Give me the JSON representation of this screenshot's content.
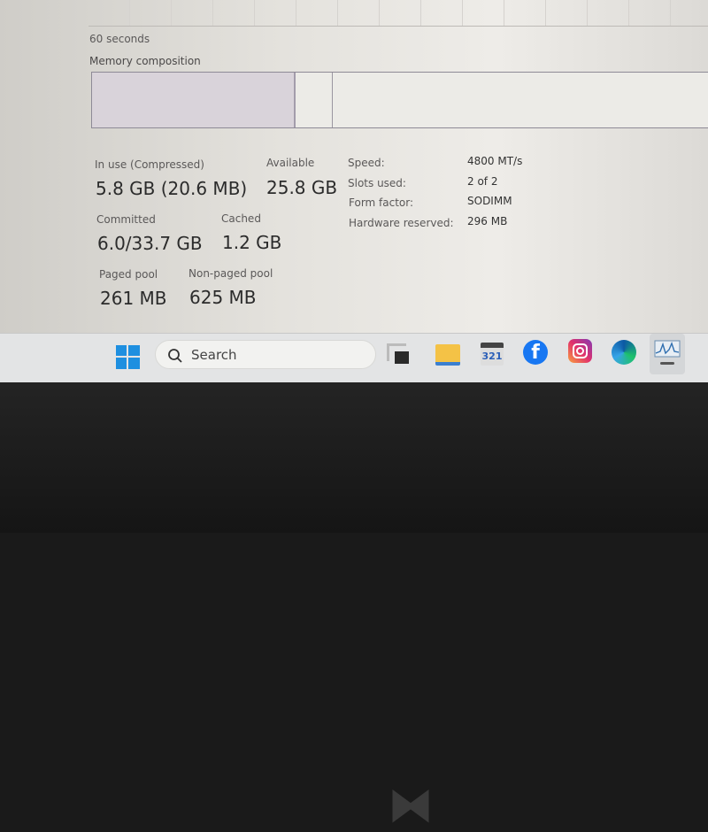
{
  "graph": {
    "time_label": "60 seconds",
    "composition_label": "Memory composition"
  },
  "stats": {
    "in_use_label": "In use (Compressed)",
    "in_use_value": "5.8 GB (20.6 MB)",
    "available_label": "Available",
    "available_value": "25.8 GB",
    "committed_label": "Committed",
    "committed_value": "6.0/33.7 GB",
    "cached_label": "Cached",
    "cached_value": "1.2 GB",
    "paged_label": "Paged pool",
    "paged_value": "261 MB",
    "nonpaged_label": "Non-paged pool",
    "nonpaged_value": "625 MB"
  },
  "details": [
    {
      "label": "Speed:",
      "value": "4800 MT/s"
    },
    {
      "label": "Slots used:",
      "value": "2 of 2"
    },
    {
      "label": "Form factor:",
      "value": "SODIMM"
    },
    {
      "label": "Hardware reserved:",
      "value": "296 MB"
    }
  ],
  "taskbar": {
    "search_placeholder": "Search",
    "apps": [
      "start-icon",
      "task-view-icon",
      "file-explorer-icon",
      "media-player-icon",
      "facebook-icon",
      "instagram-icon",
      "edge-icon",
      "task-manager-icon"
    ],
    "media_badge": "321",
    "facebook_glyph": "f"
  }
}
